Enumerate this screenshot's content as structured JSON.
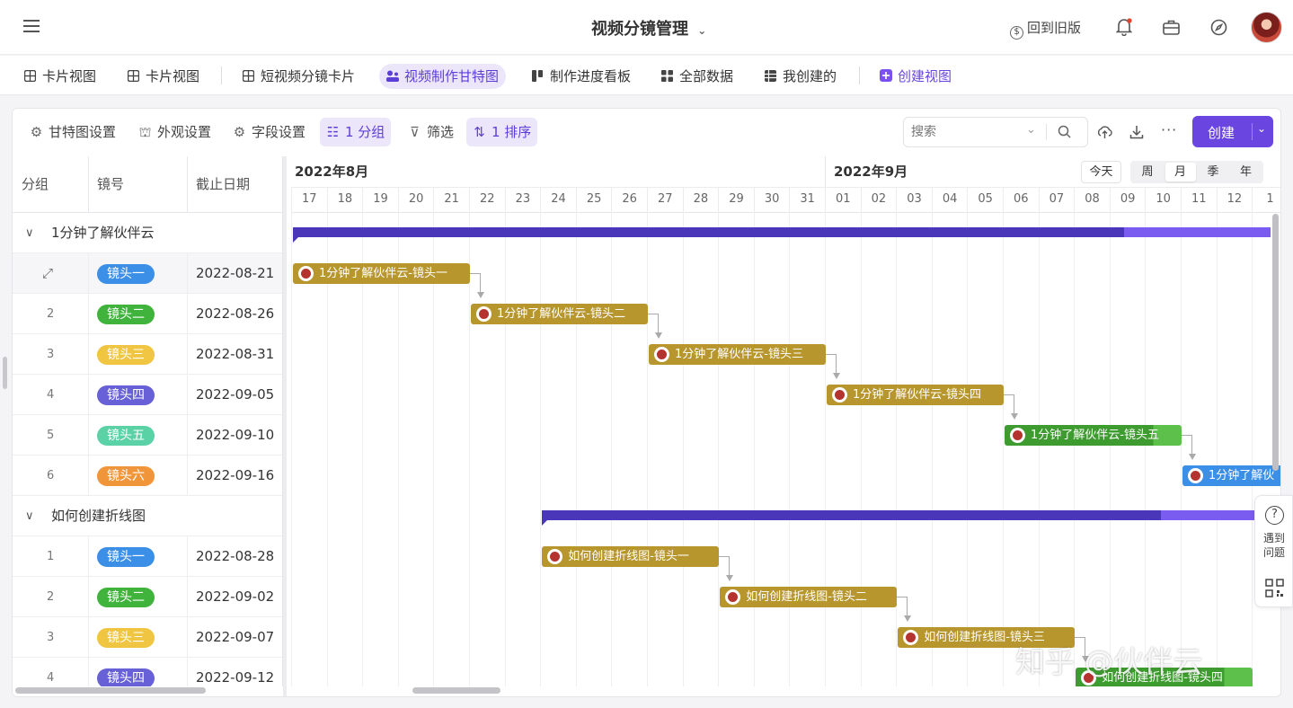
{
  "top": {
    "title": "视频分镜管理",
    "old_version": "回到旧版"
  },
  "tabs": [
    {
      "label": "卡片视图"
    },
    {
      "label": "卡片视图"
    },
    {
      "label": "短视频分镜卡片"
    },
    {
      "label": "视频制作甘特图"
    },
    {
      "label": "制作进度看板"
    },
    {
      "label": "全部数据"
    },
    {
      "label": "我创建的"
    },
    {
      "label": "创建视图"
    }
  ],
  "toolbar": {
    "gantt_settings": "甘特图设置",
    "appearance": "外观设置",
    "fields": "字段设置",
    "group": "1 分组",
    "filter": "筛选",
    "sort": "1 排序",
    "search_placeholder": "搜索",
    "create": "创建",
    "more": "···"
  },
  "columns": {
    "group": "分组",
    "shot": "镜号",
    "deadline": "截止日期"
  },
  "groups": [
    {
      "name": "1分钟了解伙伴云",
      "rows": [
        {
          "idx": "",
          "shot": "镜头一",
          "color": "#3b8fe6",
          "date": "2022-08-21",
          "bar": "1分钟了解伙伴云-镜头一"
        },
        {
          "idx": "2",
          "shot": "镜头二",
          "color": "#3fb33b",
          "date": "2022-08-26",
          "bar": "1分钟了解伙伴云-镜头二"
        },
        {
          "idx": "3",
          "shot": "镜头三",
          "color": "#f0c541",
          "date": "2022-08-31",
          "bar": "1分钟了解伙伴云-镜头三"
        },
        {
          "idx": "4",
          "shot": "镜头四",
          "color": "#6760d6",
          "date": "2022-09-05",
          "bar": "1分钟了解伙伴云-镜头四"
        },
        {
          "idx": "5",
          "shot": "镜头五",
          "color": "#5bd1a6",
          "date": "2022-09-10",
          "bar": "1分钟了解伙伴云-镜头五"
        },
        {
          "idx": "6",
          "shot": "镜头六",
          "color": "#f1953a",
          "date": "2022-09-16",
          "bar": "1分钟了解伙"
        }
      ]
    },
    {
      "name": "如何创建折线图",
      "rows": [
        {
          "idx": "1",
          "shot": "镜头一",
          "color": "#3b8fe6",
          "date": "2022-08-28",
          "bar": "如何创建折线图-镜头一"
        },
        {
          "idx": "2",
          "shot": "镜头二",
          "color": "#3fb33b",
          "date": "2022-09-02",
          "bar": "如何创建折线图-镜头二"
        },
        {
          "idx": "3",
          "shot": "镜头三",
          "color": "#f0c541",
          "date": "2022-09-07",
          "bar": "如何创建折线图-镜头三"
        },
        {
          "idx": "4",
          "shot": "镜头四",
          "color": "#6760d6",
          "date": "2022-09-12",
          "bar": "如何创建折线图-镜头四"
        }
      ]
    }
  ],
  "timeline": {
    "month1": "2022年8月",
    "month2": "2022年9月",
    "days": [
      "17",
      "18",
      "19",
      "20",
      "21",
      "22",
      "23",
      "24",
      "25",
      "26",
      "27",
      "28",
      "29",
      "30",
      "31",
      "01",
      "02",
      "03",
      "04",
      "05",
      "06",
      "07",
      "08",
      "09",
      "10",
      "11",
      "12",
      "1"
    ],
    "today": "今天",
    "scales": [
      "周",
      "月",
      "季",
      "年"
    ],
    "active_scale": "月"
  },
  "help": {
    "label1": "遇到",
    "label2": "问题"
  },
  "watermark": "知乎 @伙伴云"
}
